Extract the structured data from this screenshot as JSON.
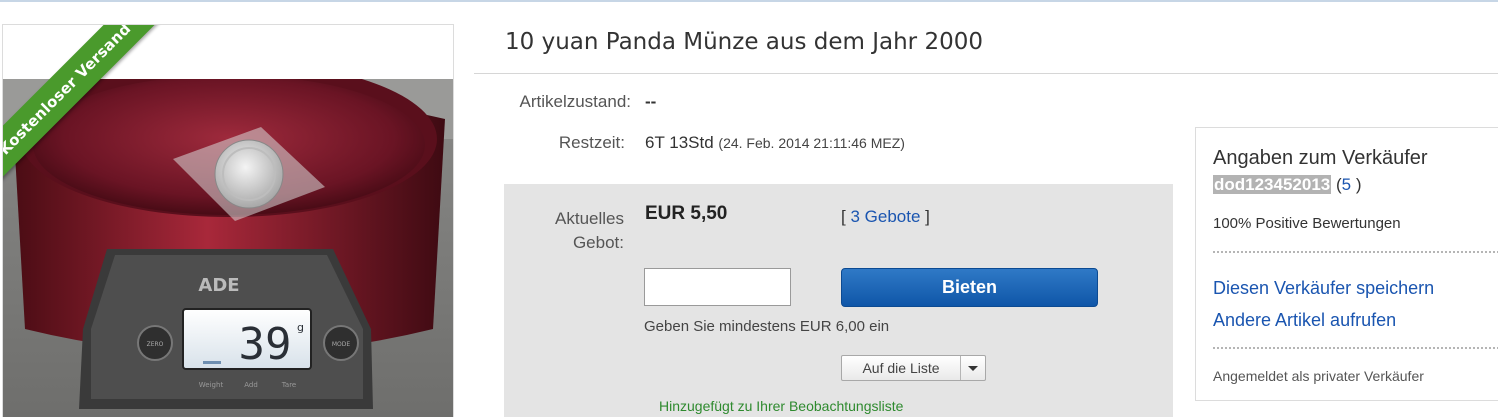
{
  "listing": {
    "title": "10 yuan Panda Münze aus dem Jahr 2000",
    "ribbon": "Kostenloser Versand",
    "condition_label": "Artikelzustand:",
    "condition_value": "--",
    "time_label": "Restzeit:",
    "time_value": "6T 13Std",
    "time_end": "(24. Feb. 2014  21:11:46 MEZ)"
  },
  "bid": {
    "current_label_1": "Aktuelles",
    "current_label_2": "Gebot:",
    "price": "EUR 5,50",
    "bids_open": "[",
    "bids_link": "3 Gebote",
    "bids_close": "]",
    "input_value": "",
    "button": "Bieten",
    "min_hint": "Geben Sie mindestens EUR 6,00 ein",
    "watch_button": "Auf die Liste",
    "watch_added": "Hinzugefügt zu Ihrer Beobachtungsliste"
  },
  "seller": {
    "title": "Angaben zum Verkäufer",
    "name": "dod123452013",
    "count_open": "(",
    "count": "5",
    "count_close": ")",
    "feedback": "100% Positive Bewertungen",
    "save_link": "Diesen Verkäufer speichern",
    "other_link": "Andere Artikel aufrufen",
    "type": "Angemeldet als privater Verkäufer"
  },
  "photo": {
    "scale_brand": "ADE",
    "display_value": "39",
    "display_unit": "g",
    "left_button": "ZERO",
    "right_button": "MODE",
    "bottom_labels": [
      "Weight",
      "Add",
      "Tare"
    ]
  },
  "colors": {
    "ribbon": "#4a9a2c",
    "link": "#1a55b0",
    "bid_button": "#1d63b5",
    "watch_added": "#2e8a2e",
    "bowl": "#7a1c2c"
  }
}
